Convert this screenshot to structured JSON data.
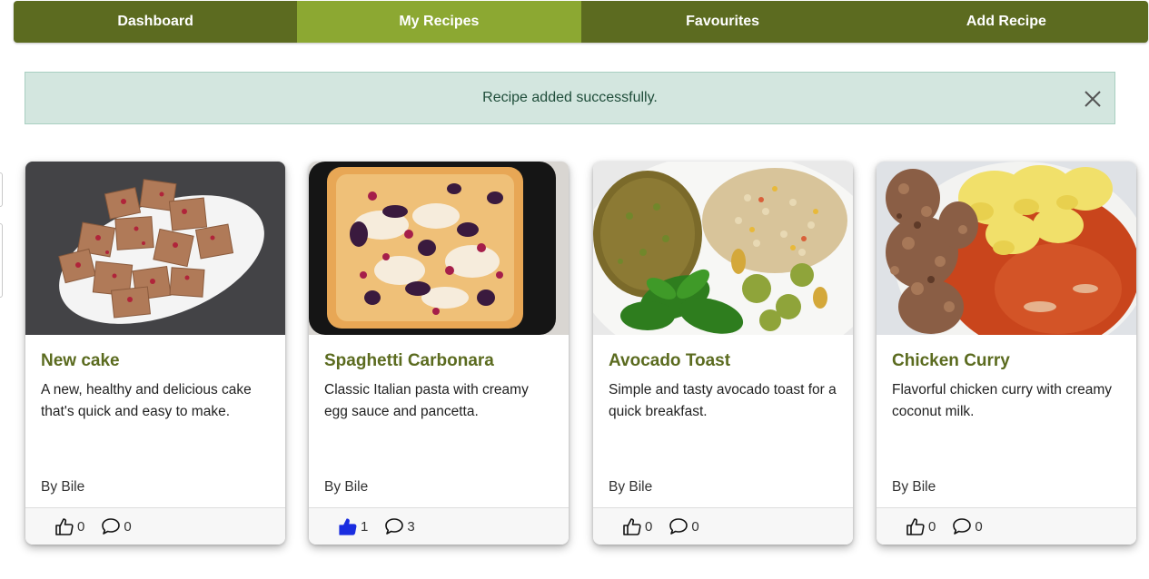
{
  "nav": {
    "tabs": [
      {
        "label": "Dashboard",
        "active": false
      },
      {
        "label": "My Recipes",
        "active": true
      },
      {
        "label": "Favourites",
        "active": false
      },
      {
        "label": "Add Recipe",
        "active": false
      }
    ]
  },
  "alert": {
    "message": "Recipe added successfully.",
    "close_icon": "close-icon"
  },
  "colors": {
    "nav_bg": "#5c6b20",
    "nav_active": "#8ca832",
    "title": "#5b6b1f",
    "alert_bg": "#d3e6df",
    "like_active": "#1a2de0"
  },
  "recipes": [
    {
      "title": "New cake",
      "description": "A new, healthy and delicious cake that's quick and easy to make.",
      "author": "By Bile",
      "likes": "0",
      "comments": "0",
      "liked": false
    },
    {
      "title": "Spaghetti Carbonara",
      "description": "Classic Italian pasta with creamy egg sauce and pancetta.",
      "author": "By Bile",
      "likes": "1",
      "comments": "3",
      "liked": true
    },
    {
      "title": "Avocado Toast",
      "description": "Simple and tasty avocado toast for a quick breakfast.",
      "author": "By Bile",
      "likes": "0",
      "comments": "0",
      "liked": false
    },
    {
      "title": "Chicken Curry",
      "description": "Flavorful chicken curry with creamy coconut milk.",
      "author": "By Bile",
      "likes": "0",
      "comments": "0",
      "liked": false
    }
  ]
}
